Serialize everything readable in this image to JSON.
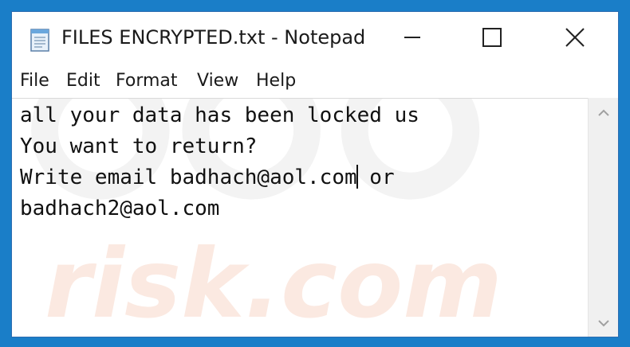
{
  "window": {
    "title": "FILES ENCRYPTED.txt - Notepad"
  },
  "menu": {
    "items": [
      "File",
      "Edit",
      "Format",
      "View",
      "Help"
    ]
  },
  "document": {
    "line1": "all your data has been locked us",
    "line2": "You want to return?",
    "line3_before_caret": "Write email badhach@aol.com",
    "line3_after_caret": " or",
    "line4": "badhach2@aol.com"
  },
  "icons": {
    "app": "notepad-icon",
    "minimize": "minimize-icon",
    "maximize": "maximize-icon",
    "close": "close-icon",
    "scroll_up": "chevron-up-icon",
    "scroll_down": "chevron-down-icon"
  },
  "colors": {
    "background_frame": "#1a7ec8",
    "window_bg": "#ffffff",
    "text": "#111111",
    "scrollbar_bg": "#f0f0f0"
  }
}
